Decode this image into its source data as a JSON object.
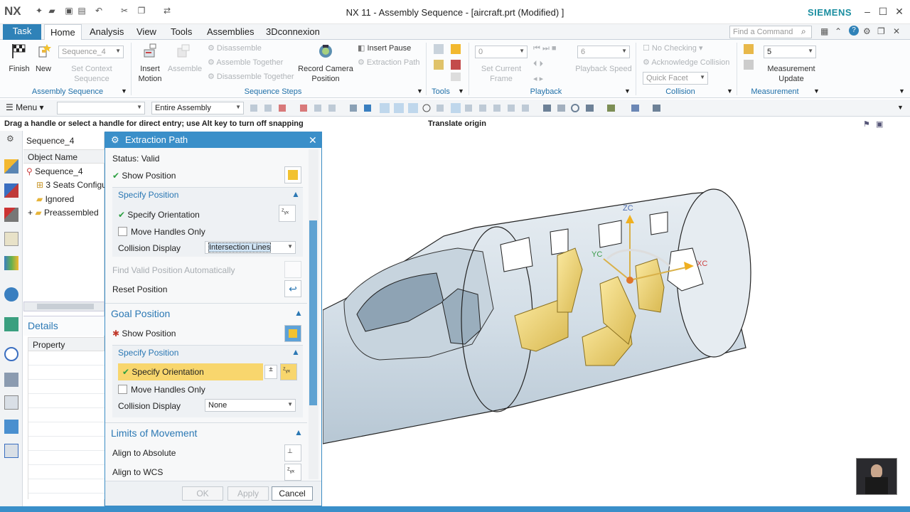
{
  "app": {
    "logo": "NX",
    "window_title": "NX 11 - Assembly Sequence - [aircraft.prt (Modified) ]",
    "brand": "SIEMENS"
  },
  "tabs": [
    "Task",
    "Home",
    "Analysis",
    "View",
    "Tools",
    "Assemblies",
    "3Dconnexion"
  ],
  "search": {
    "placeholder": "Find a Command"
  },
  "ribbon": {
    "finish": "Finish",
    "new": "New",
    "sequence_combo": "Sequence_4",
    "set_context": "Set Context Sequence",
    "group_assembly_sequence": "Assembly Sequence",
    "insert_motion": "Insert Motion",
    "assemble": "Assemble",
    "disassemble": "Disassemble",
    "assemble_together": "Assemble Together",
    "disassemble_together": "Disassemble Together",
    "record_camera": "Record Camera Position",
    "insert_pause": "Insert Pause",
    "extraction_path": "Extraction Path",
    "group_sequence_steps": "Sequence Steps",
    "group_tools": "Tools",
    "frame_value": "0",
    "set_current_frame": "Set Current Frame",
    "speed_value": "6",
    "playback_speed": "Playback Speed",
    "group_playback": "Playback",
    "no_checking": "No Checking",
    "ack_collision": "Acknowledge Collision",
    "quick_facet": "Quick Facet",
    "group_collision": "Collision",
    "measurement_value": "5",
    "measurement_update": "Measurement Update",
    "group_measurement": "Measurement"
  },
  "toolbar2": {
    "menu": "Menu",
    "filter": "",
    "scope": "Entire Assembly"
  },
  "cue": {
    "prompt": "Drag a handle or select a handle for direct entry; use Alt key to turn off snapping",
    "status": "Translate origin"
  },
  "navigator": {
    "title": "Sequence_4",
    "column": "Object Name",
    "items": [
      "Sequence_4",
      "3 Seats Configu",
      "Ignored",
      "Preassembled"
    ],
    "details_title": "Details",
    "details_column": "Property"
  },
  "dialog": {
    "title": "Extraction Path",
    "status": "Status: Valid",
    "show_position": "Show Position",
    "specify_position": "Specify Position",
    "specify_orientation": "Specify Orientation",
    "move_handles_only": "Move Handles Only",
    "collision_display": "Collision Display",
    "collision_value_1": "Intersection Lines",
    "find_valid": "Find Valid Position Automatically",
    "reset_position": "Reset Position",
    "goal_position": "Goal Position",
    "goal_show_position": "Show Position",
    "goal_specify_position": "Specify Position",
    "goal_specify_orientation": "Specify Orientation",
    "goal_move_handles_only": "Move Handles Only",
    "goal_collision_display": "Collision Display",
    "collision_value_2": "None",
    "limits": "Limits of Movement",
    "align_absolute": "Align to Absolute",
    "align_wcs": "Align to WCS",
    "ok": "OK",
    "apply": "Apply",
    "cancel": "Cancel"
  },
  "viewport": {
    "zc": "ZC",
    "yc": "YC",
    "xc": "XC"
  },
  "colors": {
    "accent": "#3a8fc9",
    "task_tab": "#2f82b8",
    "seat": "#f0d97a",
    "highlight": "#f8d66d"
  }
}
